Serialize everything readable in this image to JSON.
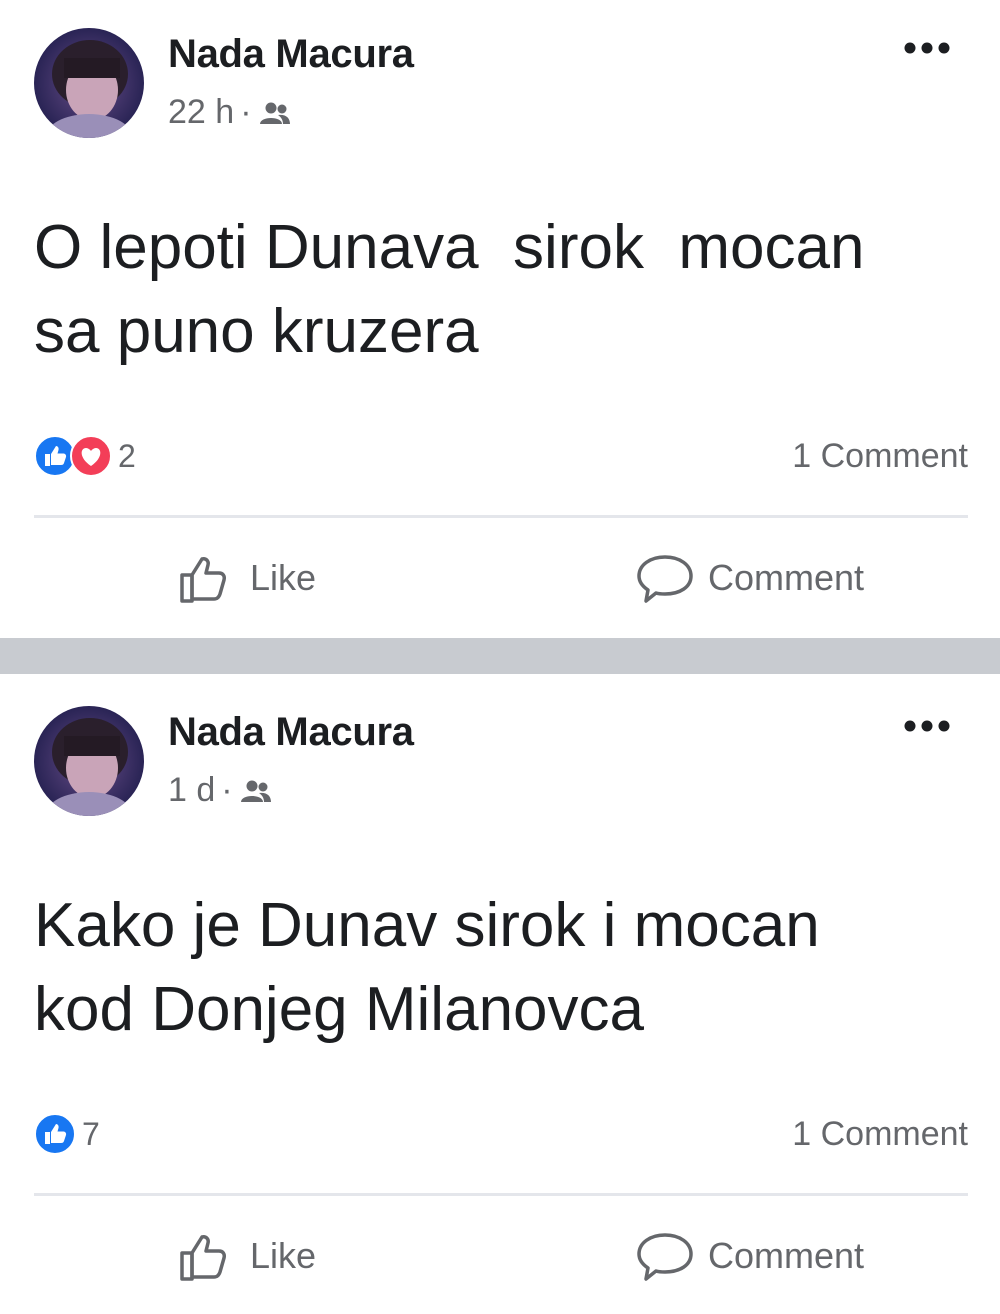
{
  "posts": [
    {
      "author": "Nada Macura",
      "time": "22 h",
      "separator": "·",
      "audience_icon": "friends-icon",
      "text": "O lepoti Dunava  sirok  mocan\nsa puno kruzera",
      "reactions": [
        "like-reaction-icon",
        "love-reaction-icon"
      ],
      "reaction_count": "2",
      "comment_count": "1 Comment",
      "like_label": "Like",
      "comment_label": "Comment"
    },
    {
      "author": "Nada Macura",
      "time": "1 d",
      "separator": "·",
      "audience_icon": "friends-icon",
      "text": "Kako je Dunav sirok i mocan\nkod Donjeg Milanovca",
      "reactions": [
        "like-reaction-icon"
      ],
      "reaction_count": "7",
      "comment_count": "1 Comment",
      "like_label": "Like",
      "comment_label": "Comment"
    }
  ],
  "colors": {
    "like_blue": "#1877f2",
    "love_red": "#f33e58",
    "secondary_text": "#65676b",
    "separator": "#c8cbd0"
  }
}
